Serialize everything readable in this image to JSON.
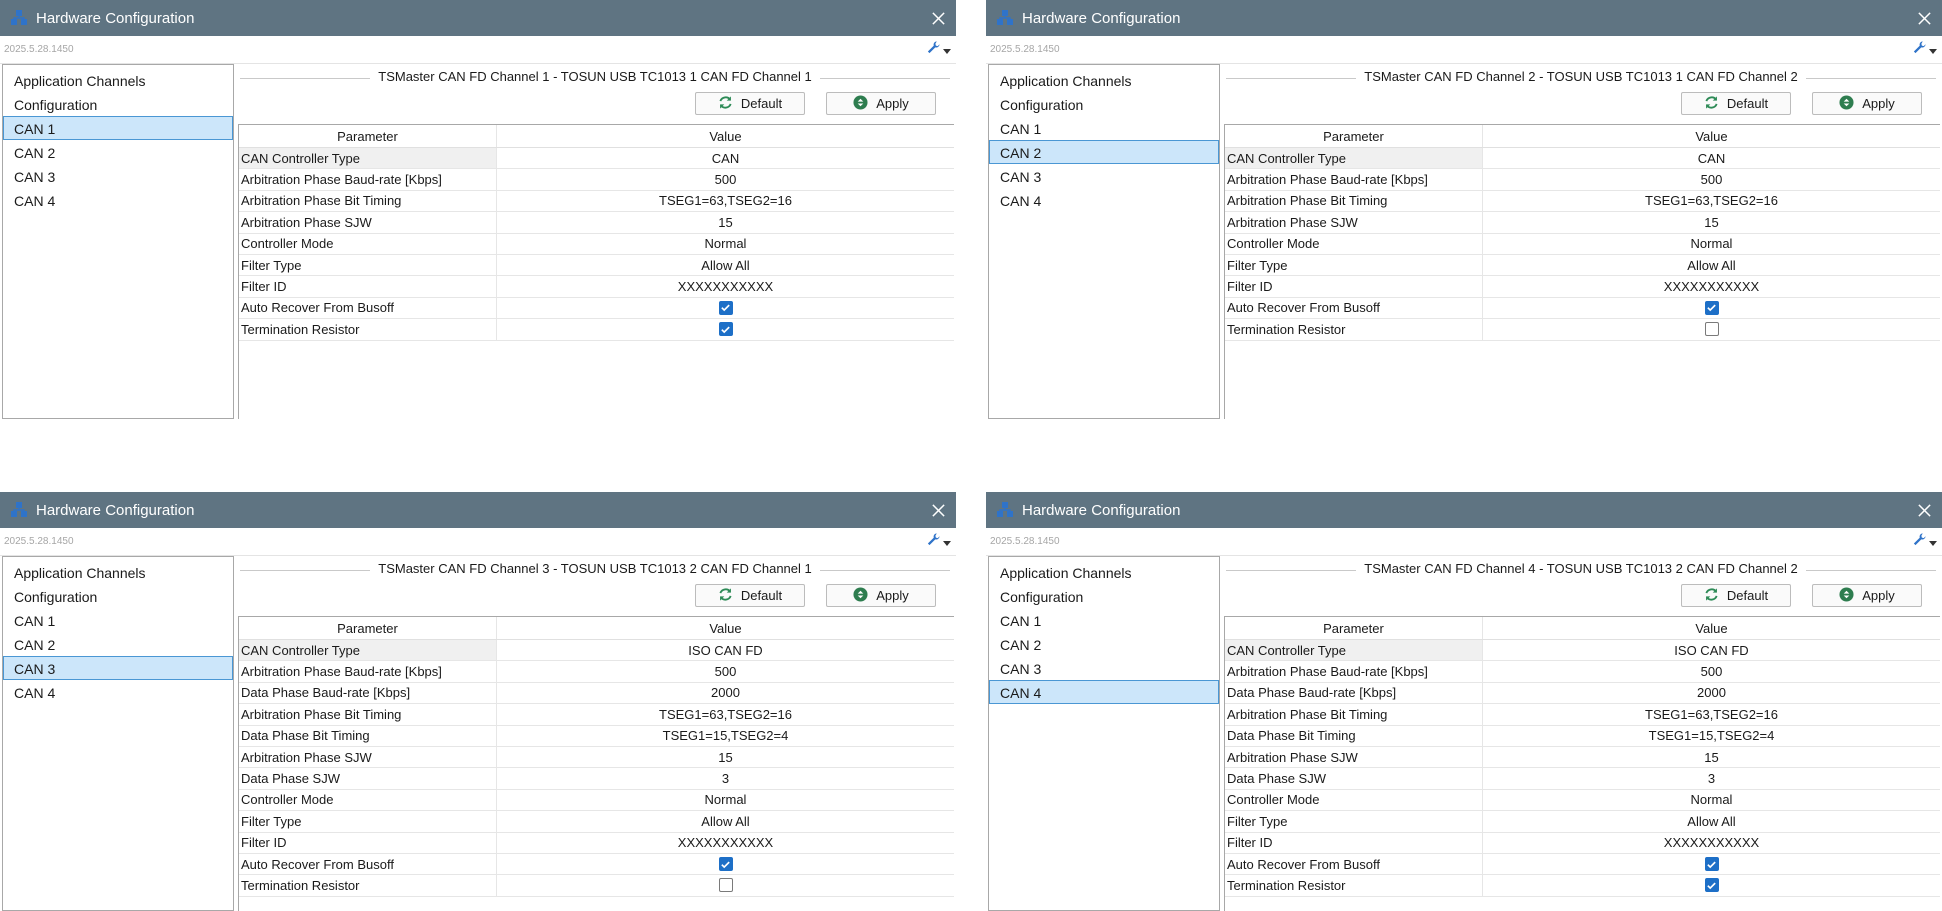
{
  "windows": [
    {
      "title": "Hardware Configuration",
      "version": "2025.5.28.1450",
      "tree": [
        "Application Channels",
        "Configuration",
        "CAN 1",
        "CAN 2",
        "CAN 3",
        "CAN 4"
      ],
      "selected": 2,
      "group_title": "TSMaster CAN FD Channel 1 - TOSUN USB TC1013 1 CAN FD Channel 1",
      "default_label": "Default",
      "apply_label": "Apply",
      "columns": [
        "Parameter",
        "Value"
      ],
      "rows": [
        {
          "param": "CAN Controller Type",
          "value": "CAN"
        },
        {
          "param": "Arbitration Phase Baud-rate [Kbps]",
          "value": "500"
        },
        {
          "param": "Arbitration Phase Bit Timing",
          "value": "TSEG1=63,TSEG2=16"
        },
        {
          "param": "Arbitration Phase SJW",
          "value": "15"
        },
        {
          "param": "Controller Mode",
          "value": "Normal"
        },
        {
          "param": "Filter Type",
          "value": "Allow All"
        },
        {
          "param": "Filter ID",
          "value": "XXXXXXXXXXX"
        },
        {
          "param": "Auto Recover From Busoff",
          "checked": true
        },
        {
          "param": "Termination Resistor",
          "checked": true
        }
      ]
    },
    {
      "title": "Hardware Configuration",
      "version": "2025.5.28.1450",
      "tree": [
        "Application Channels",
        "Configuration",
        "CAN 1",
        "CAN 2",
        "CAN 3",
        "CAN 4"
      ],
      "selected": 3,
      "group_title": "TSMaster CAN FD Channel 2 - TOSUN USB TC1013 1 CAN FD Channel 2",
      "default_label": "Default",
      "apply_label": "Apply",
      "columns": [
        "Parameter",
        "Value"
      ],
      "rows": [
        {
          "param": "CAN Controller Type",
          "value": "CAN"
        },
        {
          "param": "Arbitration Phase Baud-rate [Kbps]",
          "value": "500"
        },
        {
          "param": "Arbitration Phase Bit Timing",
          "value": "TSEG1=63,TSEG2=16"
        },
        {
          "param": "Arbitration Phase SJW",
          "value": "15"
        },
        {
          "param": "Controller Mode",
          "value": "Normal"
        },
        {
          "param": "Filter Type",
          "value": "Allow All"
        },
        {
          "param": "Filter ID",
          "value": "XXXXXXXXXXX"
        },
        {
          "param": "Auto Recover From Busoff",
          "checked": true
        },
        {
          "param": "Termination Resistor",
          "checked": false
        }
      ]
    },
    {
      "title": "Hardware Configuration",
      "version": "2025.5.28.1450",
      "tree": [
        "Application Channels",
        "Configuration",
        "CAN 1",
        "CAN 2",
        "CAN 3",
        "CAN 4"
      ],
      "selected": 4,
      "group_title": "TSMaster CAN FD Channel 3 - TOSUN USB TC1013 2 CAN FD Channel 1",
      "default_label": "Default",
      "apply_label": "Apply",
      "columns": [
        "Parameter",
        "Value"
      ],
      "rows": [
        {
          "param": "CAN Controller Type",
          "value": "ISO CAN FD"
        },
        {
          "param": "Arbitration Phase Baud-rate [Kbps]",
          "value": "500"
        },
        {
          "param": "Data Phase Baud-rate [Kbps]",
          "value": "2000"
        },
        {
          "param": "Arbitration Phase Bit Timing",
          "value": "TSEG1=63,TSEG2=16"
        },
        {
          "param": "Data Phase Bit Timing",
          "value": "TSEG1=15,TSEG2=4"
        },
        {
          "param": "Arbitration Phase SJW",
          "value": "15"
        },
        {
          "param": "Data Phase SJW",
          "value": "3"
        },
        {
          "param": "Controller Mode",
          "value": "Normal"
        },
        {
          "param": "Filter Type",
          "value": "Allow All"
        },
        {
          "param": "Filter ID",
          "value": "XXXXXXXXXXX"
        },
        {
          "param": "Auto Recover From Busoff",
          "checked": true
        },
        {
          "param": "Termination Resistor",
          "checked": false
        }
      ]
    },
    {
      "title": "Hardware Configuration",
      "version": "2025.5.28.1450",
      "tree": [
        "Application Channels",
        "Configuration",
        "CAN 1",
        "CAN 2",
        "CAN 3",
        "CAN 4"
      ],
      "selected": 5,
      "group_title": "TSMaster CAN FD Channel 4 - TOSUN USB TC1013 2 CAN FD Channel 2",
      "default_label": "Default",
      "apply_label": "Apply",
      "columns": [
        "Parameter",
        "Value"
      ],
      "rows": [
        {
          "param": "CAN Controller Type",
          "value": "ISO CAN FD"
        },
        {
          "param": "Arbitration Phase Baud-rate [Kbps]",
          "value": "500"
        },
        {
          "param": "Data Phase Baud-rate [Kbps]",
          "value": "2000"
        },
        {
          "param": "Arbitration Phase Bit Timing",
          "value": "TSEG1=63,TSEG2=16"
        },
        {
          "param": "Data Phase Bit Timing",
          "value": "TSEG1=15,TSEG2=4"
        },
        {
          "param": "Arbitration Phase SJW",
          "value": "15"
        },
        {
          "param": "Data Phase SJW",
          "value": "3"
        },
        {
          "param": "Controller Mode",
          "value": "Normal"
        },
        {
          "param": "Filter Type",
          "value": "Allow All"
        },
        {
          "param": "Filter ID",
          "value": "XXXXXXXXXXX"
        },
        {
          "param": "Auto Recover From Busoff",
          "checked": true
        },
        {
          "param": "Termination Resistor",
          "checked": true
        }
      ]
    }
  ]
}
